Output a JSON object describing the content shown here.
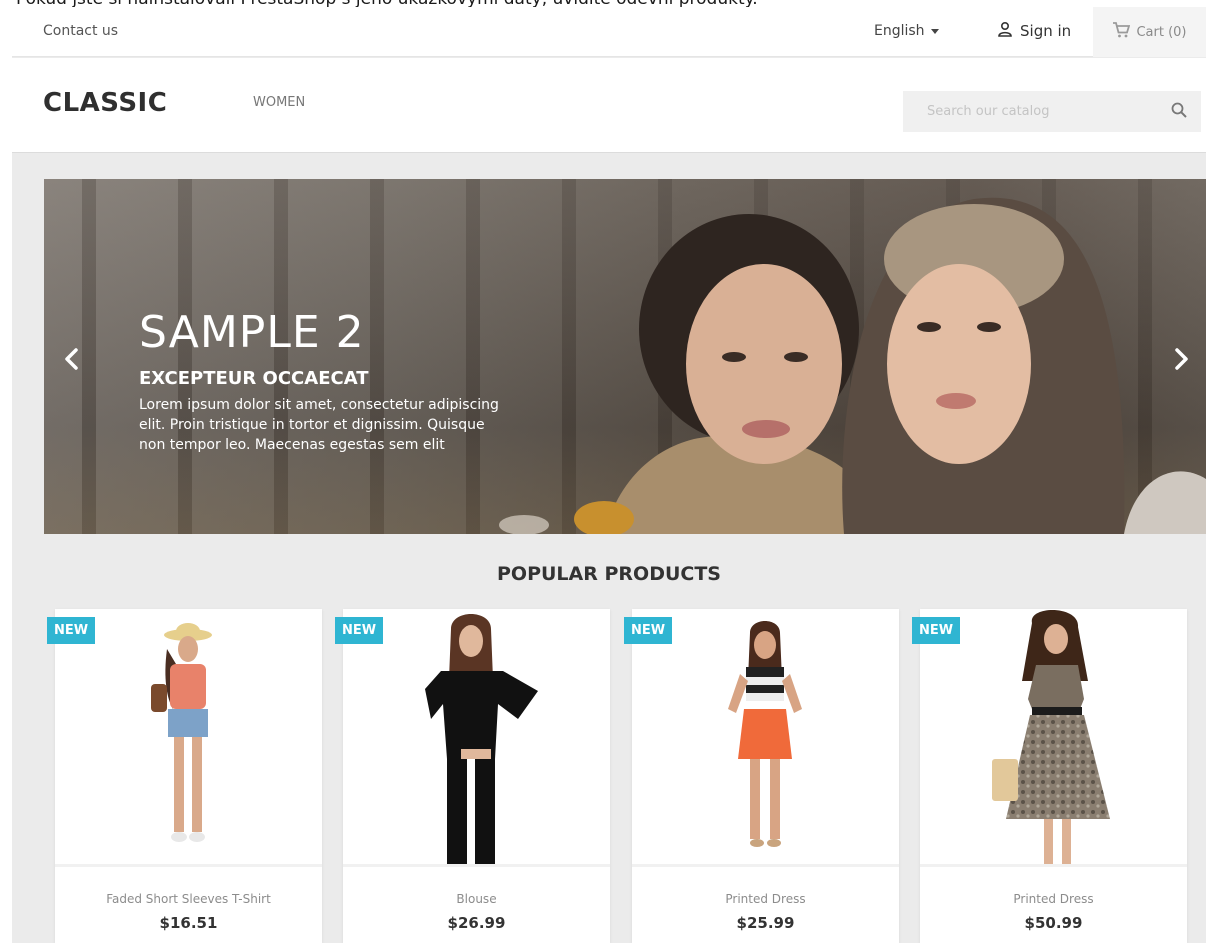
{
  "caption": "Pokud jste si nainstalovali PrestaShop s jeho ukázkovými daty, uvidíte oděvní produkty.",
  "topnav": {
    "contact": "Contact us",
    "language": "English",
    "signin": "Sign in",
    "cart": "Cart (0)"
  },
  "header": {
    "logo": "CLASSIC",
    "menu_women": "WOMEN",
    "search_placeholder": "Search our catalog"
  },
  "slider": {
    "title": "SAMPLE 2",
    "subtitle": "EXCEPTEUR OCCAECAT",
    "description": "Lorem ipsum dolor sit amet, consectetur adipiscing elit. Proin tristique in tortor et dignissim. Quisque non tempor leo. Maecenas egestas sem elit"
  },
  "products_section": {
    "title": "POPULAR PRODUCTS",
    "items": [
      {
        "badge": "NEW",
        "name": "Faded Short Sleeves T-Shirt",
        "price": "$16.51"
      },
      {
        "badge": "NEW",
        "name": "Blouse",
        "price": "$26.99"
      },
      {
        "badge": "NEW",
        "name": "Printed Dress",
        "price": "$25.99"
      },
      {
        "badge": "NEW",
        "name": "Printed Dress",
        "price": "$50.99"
      }
    ]
  },
  "colors": {
    "badge": "#2fb5d2",
    "page_bg": "#ebebeb"
  },
  "icons": [
    "user-icon",
    "cart-icon",
    "search-icon",
    "chevron-left-icon",
    "chevron-right-icon",
    "caret-down-icon"
  ]
}
